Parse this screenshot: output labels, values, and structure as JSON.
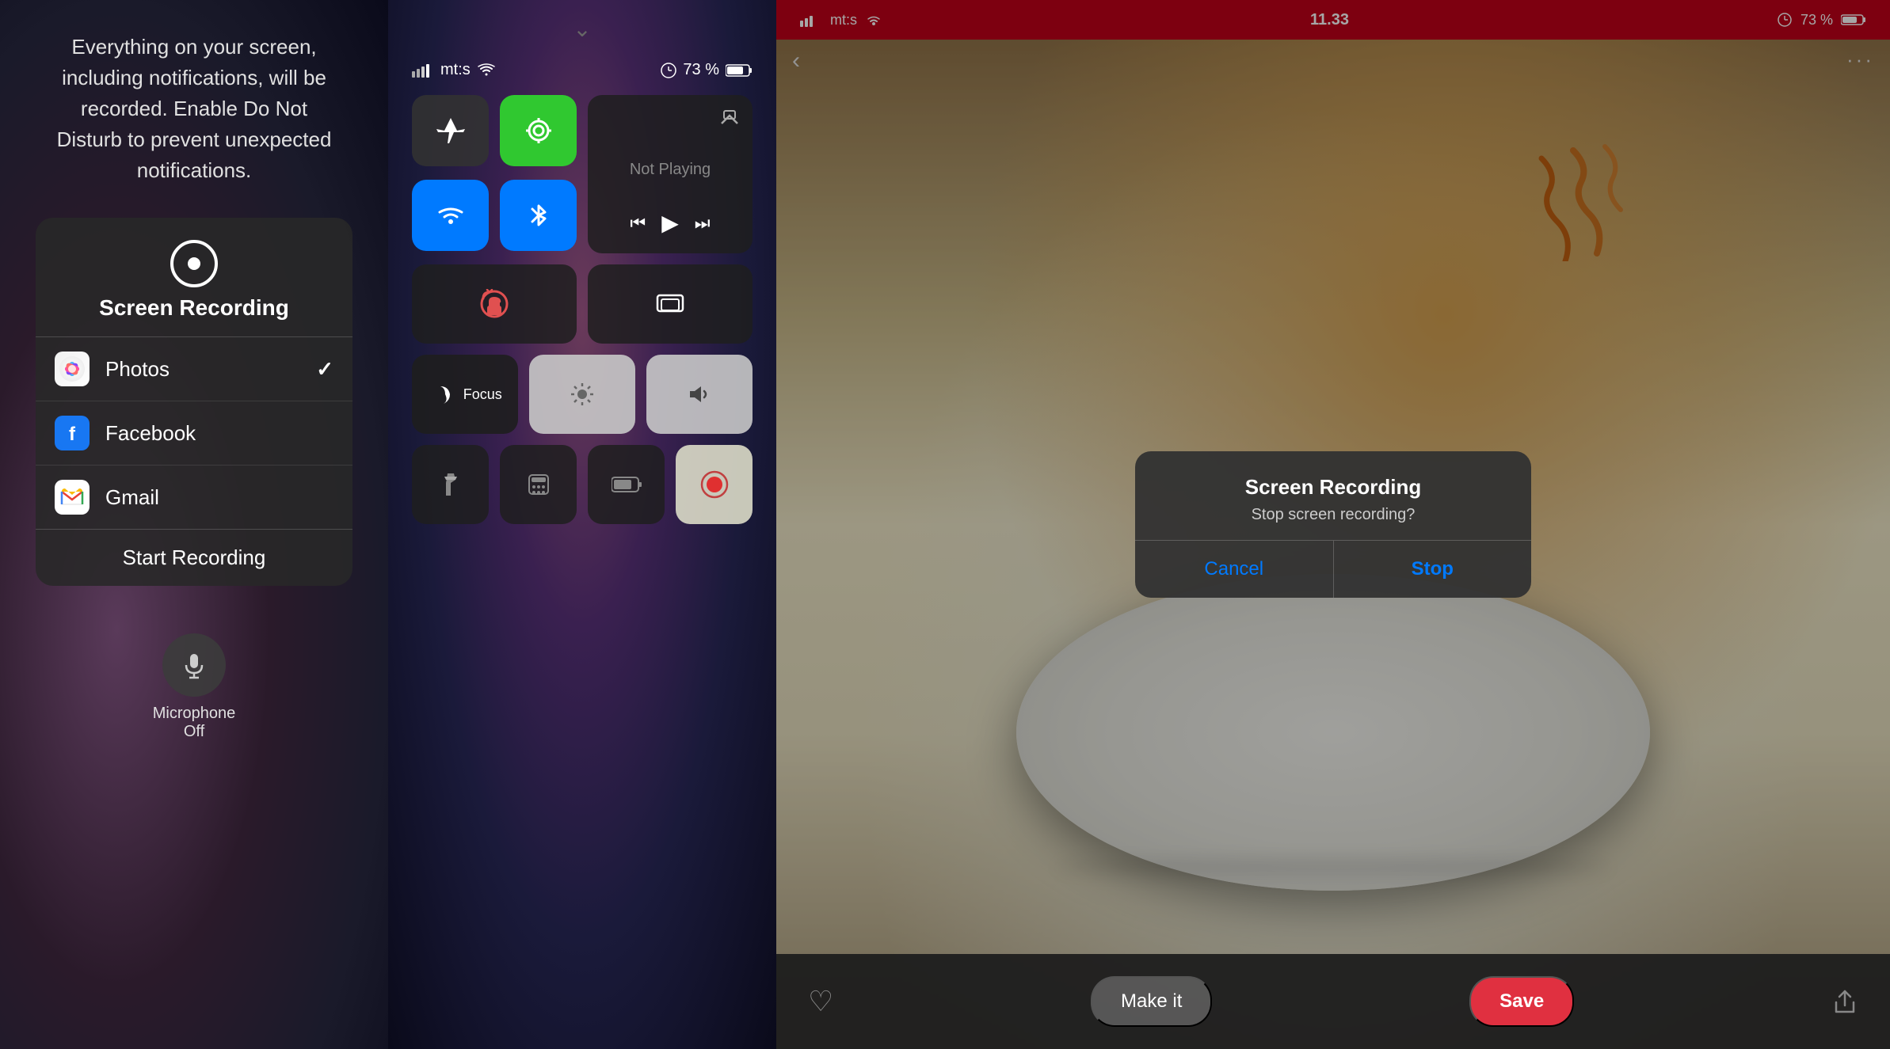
{
  "panel1": {
    "notice": "Everything on your screen, including notifications, will be recorded. Enable Do Not Disturb to prevent unexpected notifications.",
    "card": {
      "title": "Screen Recording",
      "items": [
        {
          "name": "Photos",
          "checked": true
        },
        {
          "name": "Facebook",
          "checked": false
        },
        {
          "name": "Gmail",
          "checked": false
        }
      ],
      "start_button": "Start Recording"
    },
    "mic": {
      "label": "Microphone\nOff"
    }
  },
  "panel2": {
    "status": {
      "carrier": "mt:s",
      "time": "",
      "battery": "73 %"
    },
    "media": {
      "not_playing": "Not Playing"
    },
    "focus_label": "Focus"
  },
  "panel3": {
    "status_bar": {
      "carrier": "mt:s",
      "time": "11.33",
      "battery": "73 %"
    },
    "dialog": {
      "title": "Screen Recording",
      "subtitle": "Stop screen recording?",
      "cancel": "Cancel",
      "stop": "Stop"
    },
    "bottom": {
      "make_it": "Make it",
      "save": "Save"
    }
  }
}
